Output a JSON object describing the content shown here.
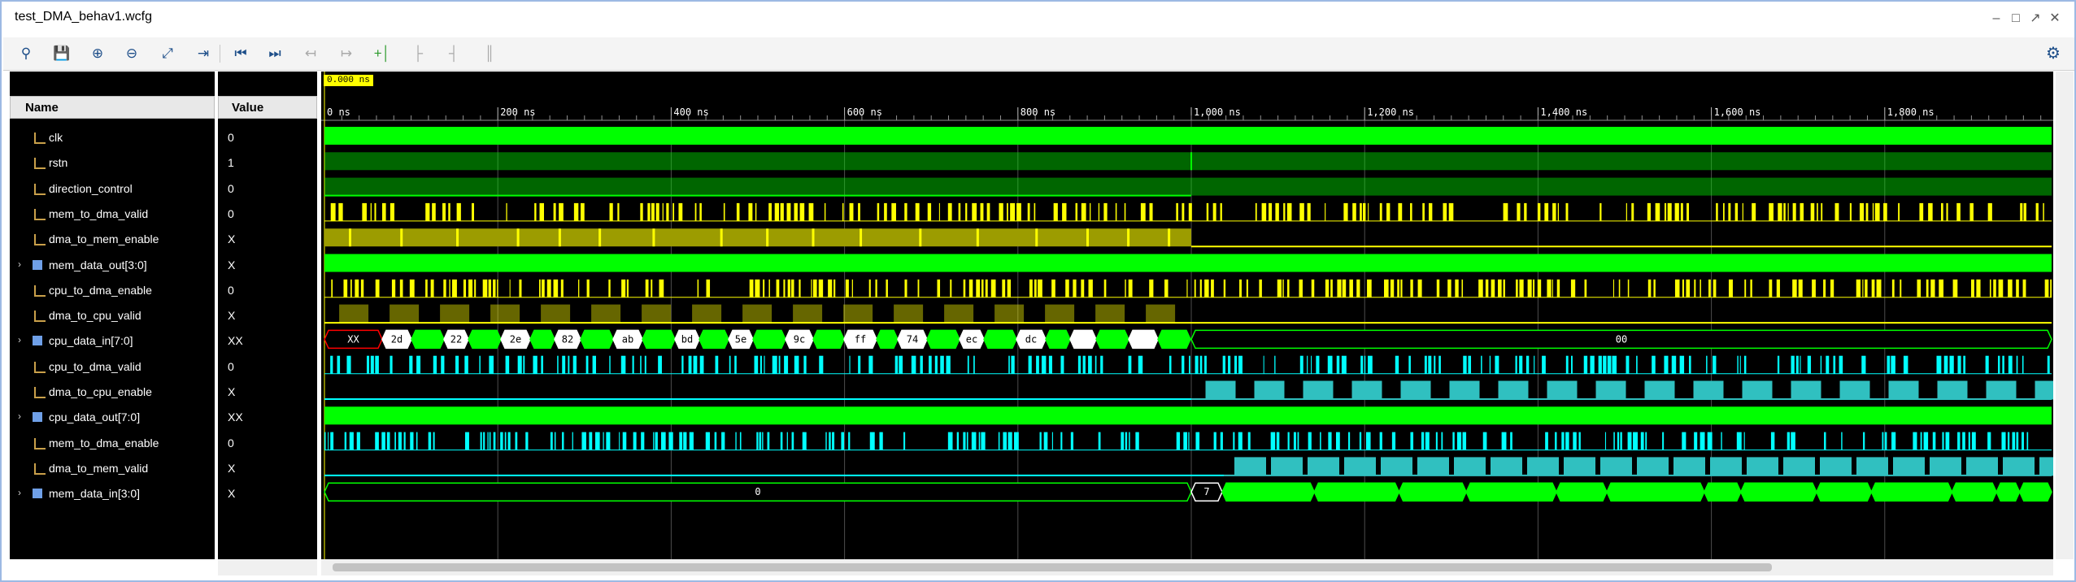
{
  "window": {
    "title": "test_DMA_behav1.wcfg"
  },
  "toolbar": {
    "icons": [
      "search-icon",
      "save-icon",
      "zoom-in-icon",
      "zoom-out-icon",
      "zoom-fit-icon",
      "go-to-cursor-icon",
      "go-to-time-0-icon",
      "go-to-last-time-icon",
      "previous-transition-icon",
      "next-transition-icon",
      "add-marker-icon",
      "previous-marker-icon",
      "next-marker-icon",
      "swap-cursors-icon"
    ],
    "settings_icon": "gear-icon"
  },
  "columns": {
    "name": "Name",
    "value": "Value"
  },
  "cursor": {
    "time_label": "0.000 ns"
  },
  "timeline": {
    "ticks": [
      "0 ns",
      "200 ns",
      "400 ns",
      "600 ns",
      "800 ns",
      "1,000 ns",
      "1,200 ns",
      "1,400 ns",
      "1,600 ns",
      "1,800 ns"
    ]
  },
  "signals": [
    {
      "name": "clk",
      "value": "0",
      "bus": false
    },
    {
      "name": "rstn",
      "value": "1",
      "bus": false
    },
    {
      "name": "direction_control",
      "value": "0",
      "bus": false
    },
    {
      "name": "mem_to_dma_valid",
      "value": "0",
      "bus": false
    },
    {
      "name": "dma_to_mem_enable",
      "value": "X",
      "bus": false
    },
    {
      "name": "mem_data_out[3:0]",
      "value": "X",
      "bus": true
    },
    {
      "name": "cpu_to_dma_enable",
      "value": "0",
      "bus": false
    },
    {
      "name": "dma_to_cpu_valid",
      "value": "X",
      "bus": false
    },
    {
      "name": "cpu_data_in[7:0]",
      "value": "XX",
      "bus": true
    },
    {
      "name": "cpu_to_dma_valid",
      "value": "0",
      "bus": false
    },
    {
      "name": "dma_to_cpu_enable",
      "value": "X",
      "bus": false
    },
    {
      "name": "cpu_data_out[7:0]",
      "value": "XX",
      "bus": true
    },
    {
      "name": "mem_to_dma_enable",
      "value": "0",
      "bus": false
    },
    {
      "name": "dma_to_mem_valid",
      "value": "X",
      "bus": false
    },
    {
      "name": "mem_data_in[3:0]",
      "value": "X",
      "bus": true
    }
  ],
  "bus_labels": {
    "cpu_data_in": [
      "XX",
      "2d",
      "22",
      "2e",
      "82",
      "ab",
      "bd",
      "5e",
      "9c",
      "ff",
      "74",
      "ec",
      "dc",
      "00"
    ],
    "mem_data_in": [
      "0",
      "7"
    ]
  },
  "colors": {
    "green": "#00ff00",
    "yellow": "#ffff00",
    "cyan": "#00ffff",
    "red": "#ff0000",
    "background": "#000000"
  }
}
